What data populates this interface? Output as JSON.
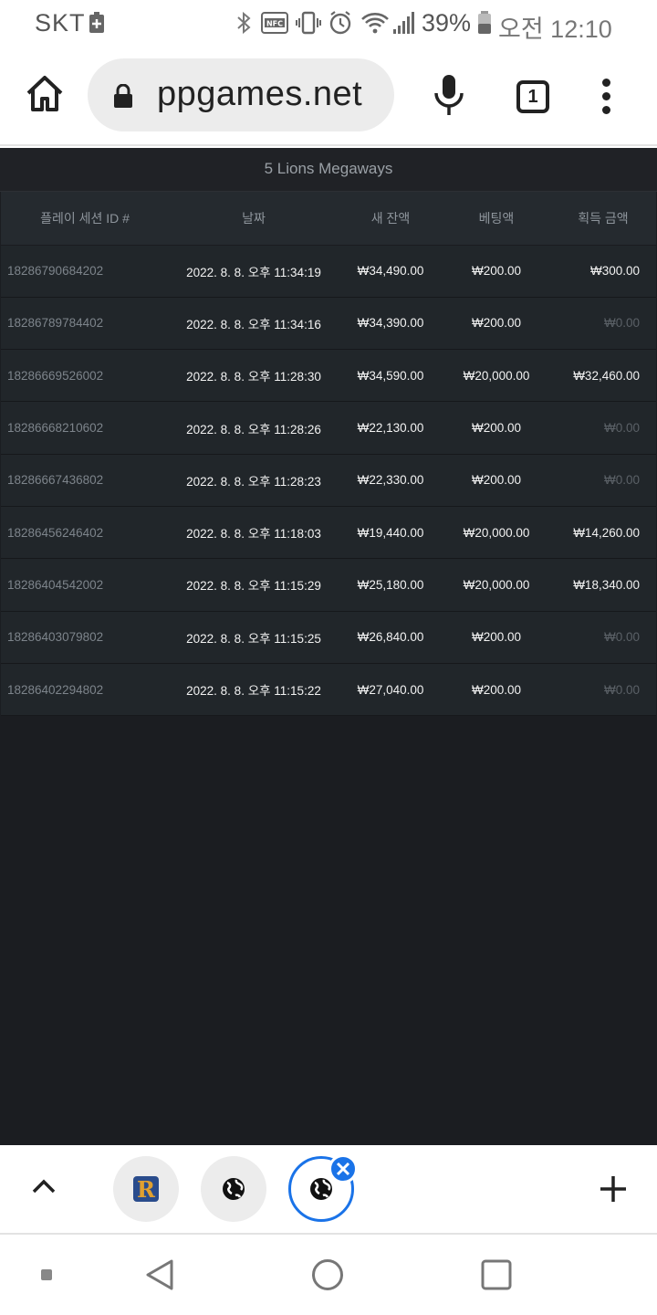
{
  "status_bar": {
    "carrier": "SKT",
    "battery_percent": "39%",
    "time": "오전 12:10",
    "icons": [
      "battery-saver-icon",
      "bluetooth-icon",
      "nfc-icon",
      "vibrate-icon",
      "alarm-icon",
      "wifi-icon",
      "signal-icon",
      "battery-icon"
    ]
  },
  "browser": {
    "url": "ppgames.net",
    "tab_count": "1",
    "icons": [
      "home-icon",
      "lock-icon",
      "mic-icon",
      "tabs-icon",
      "more-icon"
    ]
  },
  "page": {
    "title": "5 Lions Megaways",
    "columns": [
      "플레이 세션 ID #",
      "날짜",
      "새 잔액",
      "베팅액",
      "획득 금액"
    ],
    "rows": [
      {
        "id": "18286790684202",
        "date": "2022. 8. 8. 오후 11:34:19",
        "balance": "₩34,490.00",
        "bet": "₩200.00",
        "win": "₩300.00",
        "win_zero": false
      },
      {
        "id": "18286789784402",
        "date": "2022. 8. 8. 오후 11:34:16",
        "balance": "₩34,390.00",
        "bet": "₩200.00",
        "win": "₩0.00",
        "win_zero": true
      },
      {
        "id": "18286669526002",
        "date": "2022. 8. 8. 오후 11:28:30",
        "balance": "₩34,590.00",
        "bet": "₩20,000.00",
        "win": "₩32,460.00",
        "win_zero": false
      },
      {
        "id": "18286668210602",
        "date": "2022. 8. 8. 오후 11:28:26",
        "balance": "₩22,130.00",
        "bet": "₩200.00",
        "win": "₩0.00",
        "win_zero": true
      },
      {
        "id": "18286667436802",
        "date": "2022. 8. 8. 오후 11:28:23",
        "balance": "₩22,330.00",
        "bet": "₩200.00",
        "win": "₩0.00",
        "win_zero": true
      },
      {
        "id": "18286456246402",
        "date": "2022. 8. 8. 오후 11:18:03",
        "balance": "₩19,440.00",
        "bet": "₩20,000.00",
        "win": "₩14,260.00",
        "win_zero": false
      },
      {
        "id": "18286404542002",
        "date": "2022. 8. 8. 오후 11:15:29",
        "balance": "₩25,180.00",
        "bet": "₩20,000.00",
        "win": "₩18,340.00",
        "win_zero": false
      },
      {
        "id": "18286403079802",
        "date": "2022. 8. 8. 오후 11:15:25",
        "balance": "₩26,840.00",
        "bet": "₩200.00",
        "win": "₩0.00",
        "win_zero": true
      },
      {
        "id": "18286402294802",
        "date": "2022. 8. 8. 오후 11:15:22",
        "balance": "₩27,040.00",
        "bet": "₩200.00",
        "win": "₩0.00",
        "win_zero": true
      }
    ]
  },
  "tab_strip": {
    "tabs": [
      {
        "icon": "r-app-icon",
        "active": false
      },
      {
        "icon": "globe-icon",
        "active": false
      },
      {
        "icon": "globe-icon",
        "active": true
      }
    ],
    "icons": [
      "chevron-up-icon",
      "close-icon",
      "plus-icon"
    ]
  },
  "nav_bar": {
    "icons": [
      "recents-dot-icon",
      "back-icon",
      "home-circle-icon",
      "overview-icon"
    ]
  },
  "colors": {
    "accent": "#1a73e8",
    "content_bg": "#1b1d21",
    "row_bg": "#21262a"
  }
}
